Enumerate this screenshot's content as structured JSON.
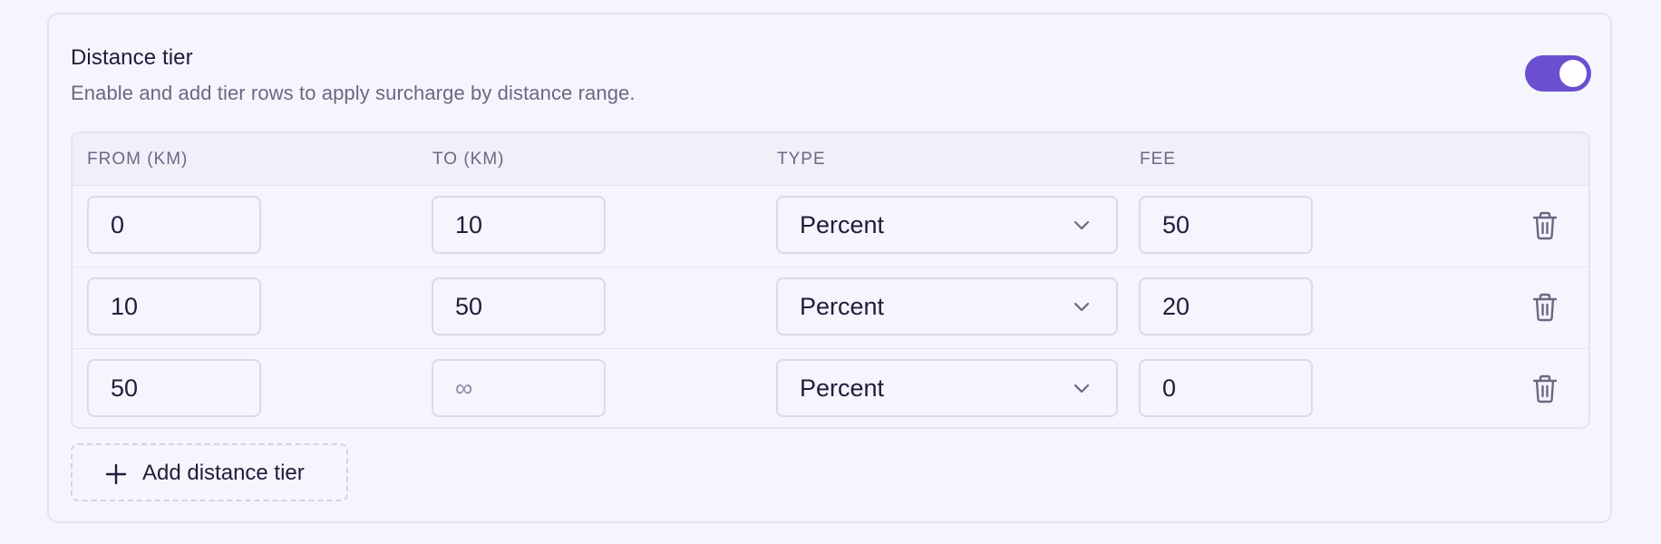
{
  "section": {
    "title": "Distance tier",
    "description": "Enable and add tier rows to apply surcharge by distance range.",
    "enabled": true,
    "accent_color": "#6b4fd1"
  },
  "table": {
    "headers": {
      "from": "FROM (KM)",
      "to": "TO (KM)",
      "type": "TYPE",
      "fee": "FEE"
    },
    "rows": [
      {
        "from": "0",
        "to": "10",
        "type": "Percent",
        "fee": "50"
      },
      {
        "from": "10",
        "to": "50",
        "type": "Percent",
        "fee": "20"
      },
      {
        "from": "50",
        "to": "",
        "to_placeholder": "∞",
        "type": "Percent",
        "fee": "0"
      }
    ],
    "row_action_icon": "trash-icon"
  },
  "add_button": {
    "label": "Add distance tier",
    "icon": "plus-icon"
  }
}
